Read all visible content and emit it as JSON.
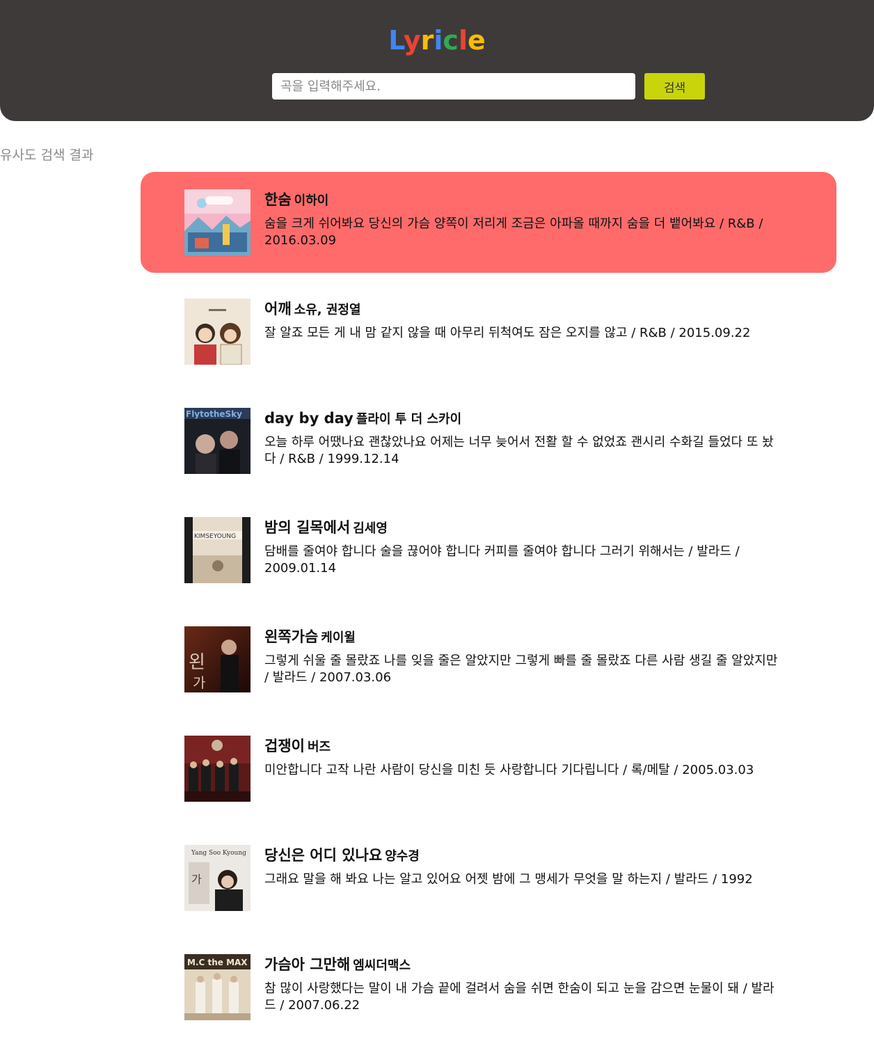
{
  "header": {
    "logo_letters": [
      {
        "char": "L",
        "color": "#4285f4"
      },
      {
        "char": "y",
        "color": "#ea4335"
      },
      {
        "char": "r",
        "color": "#fbbc05"
      },
      {
        "char": "i",
        "color": "#4285f4"
      },
      {
        "char": "c",
        "color": "#34a853"
      },
      {
        "char": "l",
        "color": "#ea4335"
      },
      {
        "char": "e",
        "color": "#fbbc05"
      }
    ],
    "search_placeholder": "곡을 입력해주세요.",
    "search_value": "",
    "search_button_label": "검색"
  },
  "colors": {
    "header_bg": "#3e3a39",
    "search_button_bg": "#c9d40b",
    "active_item_bg": "#ff6b6b"
  },
  "results_title": "유사도 검색 결과",
  "results": [
    {
      "title": "한숨",
      "artist": "이하이",
      "desc": "숨을 크게 쉬어봐요 당신의 가슴 양쪽이 저리게 조금은 아파올 때까지 숨을 더 뱉어봐요 / R&B / 2016.03.09",
      "active": true
    },
    {
      "title": "어깨",
      "artist": "소유, 권정열",
      "desc": "잘 알죠 모든 게 내 맘 같지 않을 때 아무리 뒤척여도 잠은 오지를 않고 / R&B / 2015.09.22",
      "active": false
    },
    {
      "title": "day by day",
      "artist": "플라이 투 더 스카이",
      "desc": "오늘 하루 어땠나요 괜찮았나요 어제는 너무 늦어서 전활 할 수 없었죠 괜시리 수화길 들었다 또 놨다 / R&B / 1999.12.14",
      "active": false
    },
    {
      "title": "밤의 길목에서",
      "artist": "김세영",
      "desc": "담배를 줄여야 합니다 술을 끊어야 합니다 커피를 줄여야 합니다 그러기 위해서는 / 발라드 / 2009.01.14",
      "active": false
    },
    {
      "title": "왼쪽가슴",
      "artist": "케이윌",
      "desc": "그렇게 쉬울 줄 몰랐죠 나를 잊을 줄은 알았지만 그렇게 빠를 줄 몰랐죠 다른 사람 생길 줄 알았지만 / 발라드 / 2007.03.06",
      "active": false
    },
    {
      "title": "겁쟁이",
      "artist": "버즈",
      "desc": "미안합니다 고작 나란 사람이 당신을 미친 듯 사랑합니다 기다립니다 / 록/메탈 / 2005.03.03",
      "active": false
    },
    {
      "title": "당신은 어디 있나요",
      "artist": "양수경",
      "desc": "그래요 말을 해 봐요 나는 알고 있어요 어젯 밤에 그 맹세가 무엇을 말 하는지 / 발라드 / 1992",
      "active": false
    },
    {
      "title": "가슴아 그만해",
      "artist": "엠씨더맥스",
      "desc": "참 많이 사랑했다는 말이 내 가슴 끝에 걸려서 숨을 쉬면 한숨이 되고 눈을 감으면 눈물이 돼 / 발라드 / 2007.06.22",
      "active": false
    }
  ]
}
